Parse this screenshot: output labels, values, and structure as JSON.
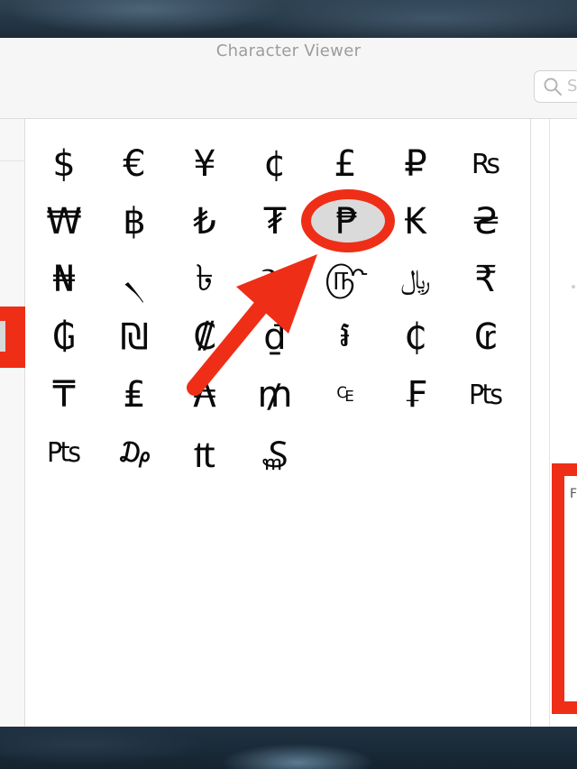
{
  "window": {
    "title": "Character Viewer"
  },
  "search": {
    "placeholder_visible": "S",
    "icon": "search-icon"
  },
  "grid": {
    "rows": [
      [
        "$",
        "€",
        "¥",
        "¢",
        "£",
        "₽",
        "₨"
      ],
      [
        "₩",
        "฿",
        "₺",
        "₮",
        "₱",
        "₭",
        "₴"
      ],
      [
        "₦",
        "৲",
        "৳",
        "૱",
        "௹",
        "﷼",
        "₹"
      ],
      [
        "₲",
        "₪",
        "₡",
        "₫",
        "៛",
        "₵",
        "₢"
      ],
      [
        "₸",
        "₤",
        "₳",
        "₥",
        "₠",
        "₣",
        "₧"
      ],
      [
        "₧",
        "₯",
        "₶",
        "₷"
      ]
    ],
    "selected": "₱"
  },
  "annotations": {
    "highlight_color": "#ef2e17",
    "arrow": "arrow pointing to selected Peso sign"
  },
  "info_panel": {
    "label_fragment": "F"
  }
}
